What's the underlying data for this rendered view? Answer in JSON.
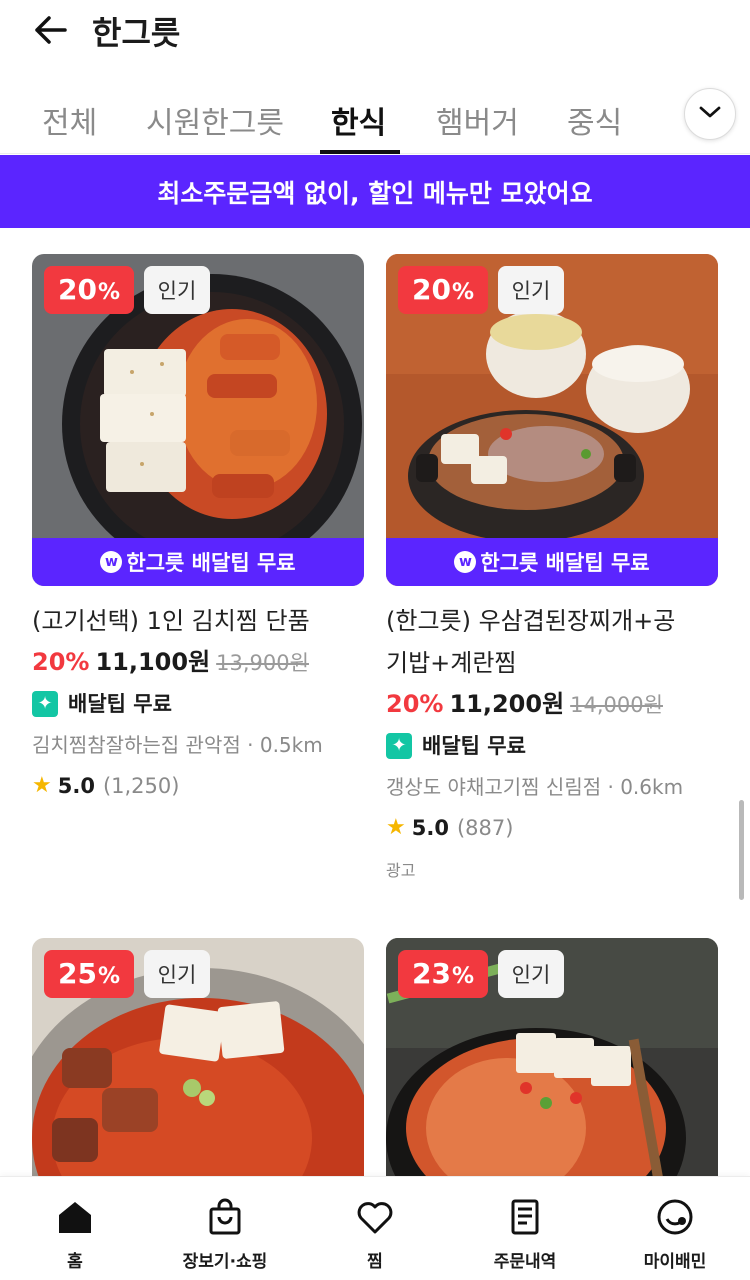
{
  "header": {
    "title": "한그릇"
  },
  "tabs": [
    {
      "label": "전체",
      "active": false
    },
    {
      "label": "시원한그릇",
      "active": false
    },
    {
      "label": "한식",
      "active": true
    },
    {
      "label": "햄버거",
      "active": false
    },
    {
      "label": "중식",
      "active": false
    }
  ],
  "banner": {
    "text": "최소주문금액 없이, 할인 메뉴만 모았어요"
  },
  "cards": [
    {
      "discount_num": "20",
      "discount_pct": "%",
      "popular": "인기",
      "free_delivery": "한그릇 배달팁 무료",
      "name": "(고기선택) 1인 김치찜 단품",
      "price_discount": "20%",
      "price": "11,100원",
      "price_original": "13,900원",
      "delivery_tip": "배달팁 무료",
      "store": "김치찜참잘하는집 관악점",
      "distance": "0.5km",
      "rating": "5.0",
      "reviews": "(1,250)"
    },
    {
      "discount_num": "20",
      "discount_pct": "%",
      "popular": "인기",
      "free_delivery": "한그릇 배달팁 무료",
      "name_line1": "(한그릇) 우삼겹된장찌개+공",
      "name_line2": "기밥+계란찜",
      "price_discount": "20%",
      "price": "11,200원",
      "price_original": "14,000원",
      "delivery_tip": "배달팁 무료",
      "store": "갱상도 야채고기찜 신림점",
      "distance": "0.6km",
      "rating": "5.0",
      "reviews": "(887)",
      "ad": "광고"
    },
    {
      "discount_num": "25",
      "discount_pct": "%",
      "popular": "인기"
    },
    {
      "discount_num": "23",
      "discount_pct": "%",
      "popular": "인기"
    }
  ],
  "bottom_nav": [
    {
      "label": "홈",
      "icon": "home-icon"
    },
    {
      "label": "장보기·쇼핑",
      "icon": "shopping-bag-icon"
    },
    {
      "label": "찜",
      "icon": "heart-icon"
    },
    {
      "label": "주문내역",
      "icon": "receipt-icon"
    },
    {
      "label": "마이배민",
      "icon": "profile-icon"
    }
  ],
  "colors": {
    "brand": "#5b25ff",
    "discount": "#f2393f",
    "tip": "#13c6a4",
    "star": "#f5b600"
  }
}
